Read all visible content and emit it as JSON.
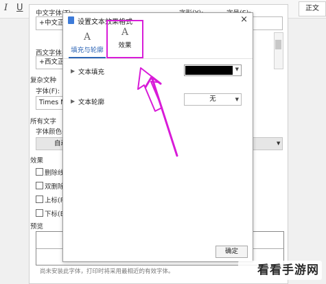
{
  "ribbon": {
    "italic": "I",
    "underline": "U",
    "style_label": "正文"
  },
  "font_dialog": {
    "cn_font_label": "中文字体(T):",
    "cn_font_value": "+中文正",
    "style_label": "字形(Y):",
    "size_label": "字号(S):",
    "west_font_label": "西文字体(",
    "west_font_value": "+西文正",
    "complex_label": "复杂文种",
    "complex_font_label": "字体(F):",
    "complex_font_value": "Times N",
    "all_text_label": "所有文字",
    "font_color_label": "字体颜色(",
    "font_color_value": "自动",
    "effects_label": "效果",
    "strike_label": "删除线",
    "dbl_strike_label": "双删除",
    "super_label": "上标(P",
    "sub_label": "下标(B",
    "preview_label": "预览",
    "footer_note": "尚未安装此字体，打印时将采用最相近的有效字体。"
  },
  "effect_dialog": {
    "title": "设置文本效果格式",
    "close": "×",
    "tabs": [
      {
        "glyph": "A",
        "label": "填充与轮廓"
      },
      {
        "glyph": "A",
        "label": "效果"
      }
    ],
    "fill_label": "文本填充",
    "outline_label": "文本轮廓",
    "outline_value": "无",
    "fill_color": "#000000",
    "ok_label": "确定"
  },
  "watermark": {
    "text": "看看手游网"
  },
  "annotation_color": "#d81bd8"
}
